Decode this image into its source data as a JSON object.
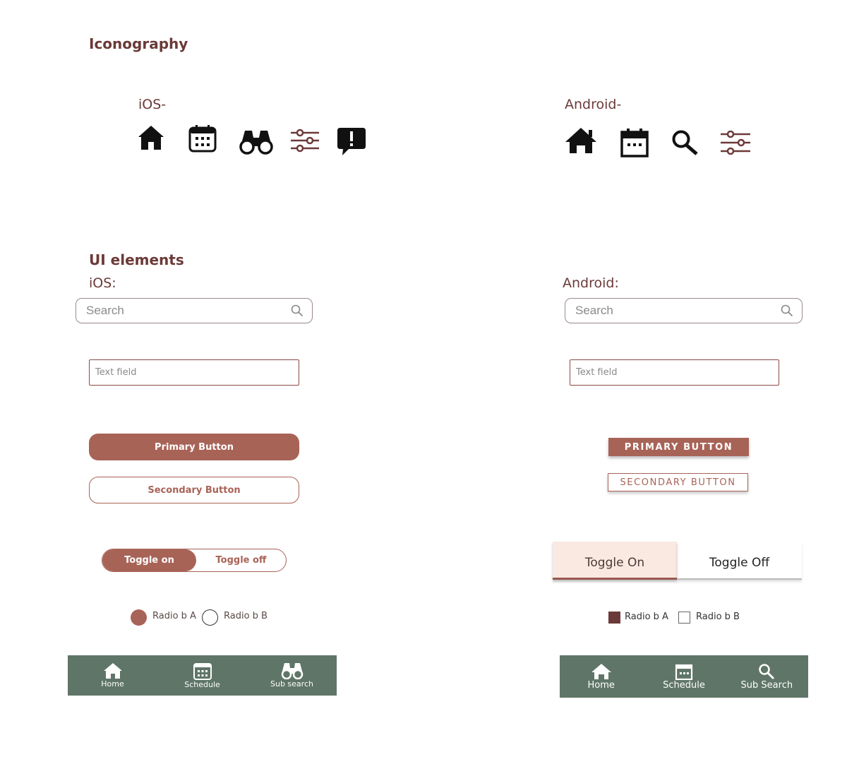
{
  "sections": {
    "iconography_title": "Iconography",
    "ui_elements_title": "UI elements"
  },
  "iconography": {
    "ios_label": "iOS-",
    "android_label": "Android-",
    "ios_icons": [
      "home-icon",
      "calendar-icon",
      "binoculars-icon",
      "sliders-icon",
      "alert-message-icon"
    ],
    "android_icons": [
      "home-icon",
      "calendar-icon",
      "search-icon",
      "sliders-icon"
    ]
  },
  "ios": {
    "label": "iOS:",
    "search_placeholder": "Search",
    "text_field_placeholder": "Text field",
    "primary_button": "Primary Button",
    "secondary_button": "Secondary Button",
    "toggle_on": "Toggle on",
    "toggle_off": "Toggle off",
    "radio_a": "Radio b A",
    "radio_b": "Radio b B",
    "nav": {
      "home": "Home",
      "schedule": "Schedule",
      "sub_search": "Sub search"
    }
  },
  "android": {
    "label": "Android:",
    "search_placeholder": "Search",
    "text_field_placeholder": "Text field",
    "primary_button": "PRIMARY BUTTON",
    "secondary_button": "SECONDARY BUTTON",
    "toggle_on": "Toggle On",
    "toggle_off": "Toggle Off",
    "radio_a": "Radio b A",
    "radio_b": "Radio b B",
    "nav": {
      "home": "Home",
      "schedule": "Schedule",
      "sub_search": "Sub Search"
    }
  },
  "colors": {
    "accent": "#a86357",
    "heading": "#6b3a38",
    "navbar": "#5f7568",
    "toggle_on_bg": "#fae9e1"
  }
}
